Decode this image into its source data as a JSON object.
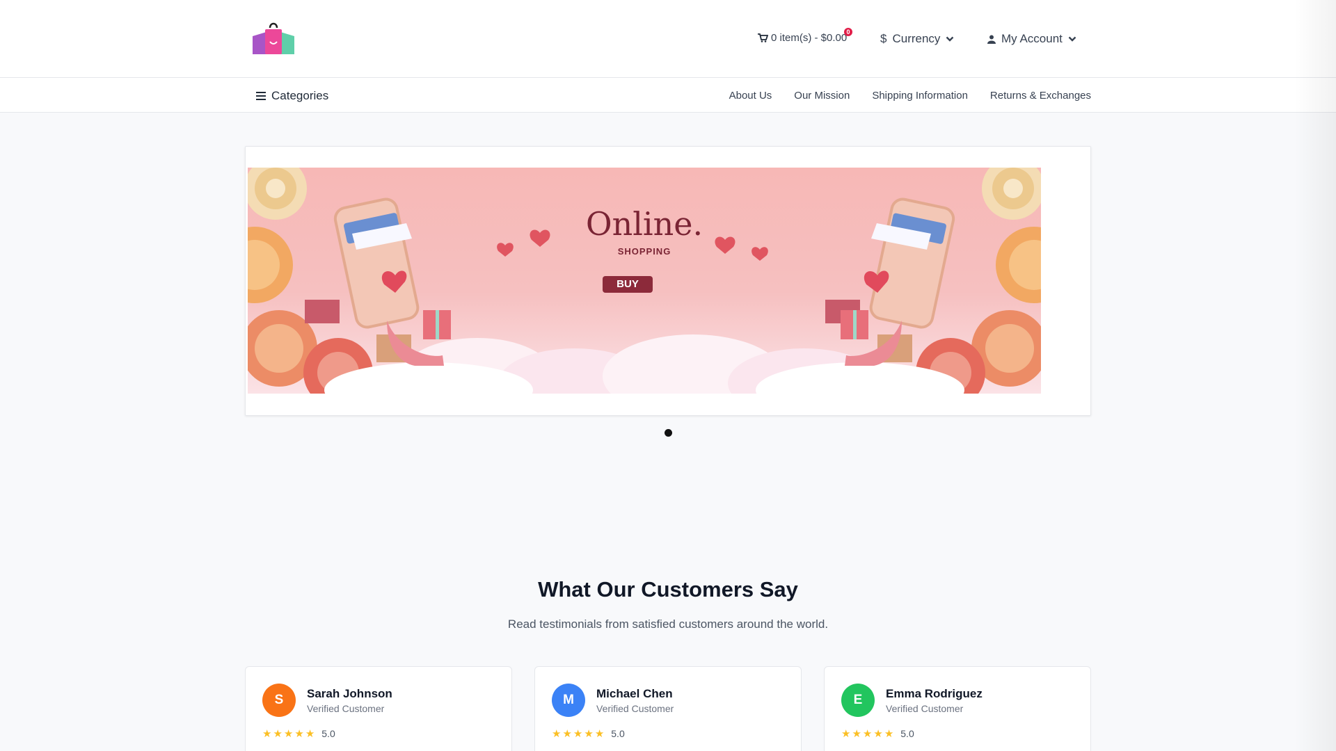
{
  "header": {
    "cart_label": "0 item(s) - $0.00",
    "cart_badge": "0",
    "currency_symbol": "$",
    "currency_label": "Currency",
    "account_label": "My Account"
  },
  "nav": {
    "categories_label": "Categories",
    "links": [
      "About Us",
      "Our Mission",
      "Shipping Information",
      "Returns & Exchanges"
    ]
  },
  "banner": {
    "title": "Online.",
    "subtitle": "SHOPPING",
    "button": "BUY"
  },
  "testimonials": {
    "title": "What Our Customers Say",
    "subtitle": "Read testimonials from satisfied customers around the world.",
    "items": [
      {
        "initial": "S",
        "name": "Sarah Johnson",
        "role": "Verified Customer",
        "rating": "5.0",
        "color": "#f97316"
      },
      {
        "initial": "M",
        "name": "Michael Chen",
        "role": "Verified Customer",
        "rating": "5.0",
        "color": "#3b82f6"
      },
      {
        "initial": "E",
        "name": "Emma Rodriguez",
        "role": "Verified Customer",
        "rating": "5.0",
        "color": "#22c55e"
      }
    ]
  },
  "icons": {
    "logo": "shopping-bag-logo",
    "cart": "cart-icon",
    "currency": "dollar-icon",
    "account": "user-icon",
    "menu": "hamburger-icon",
    "chevron": "chevron-down-icon",
    "star": "star-icon"
  },
  "colors": {
    "accent": "#e11d48",
    "banner_pink": "#f7b8b6",
    "star": "#fbbf24"
  }
}
